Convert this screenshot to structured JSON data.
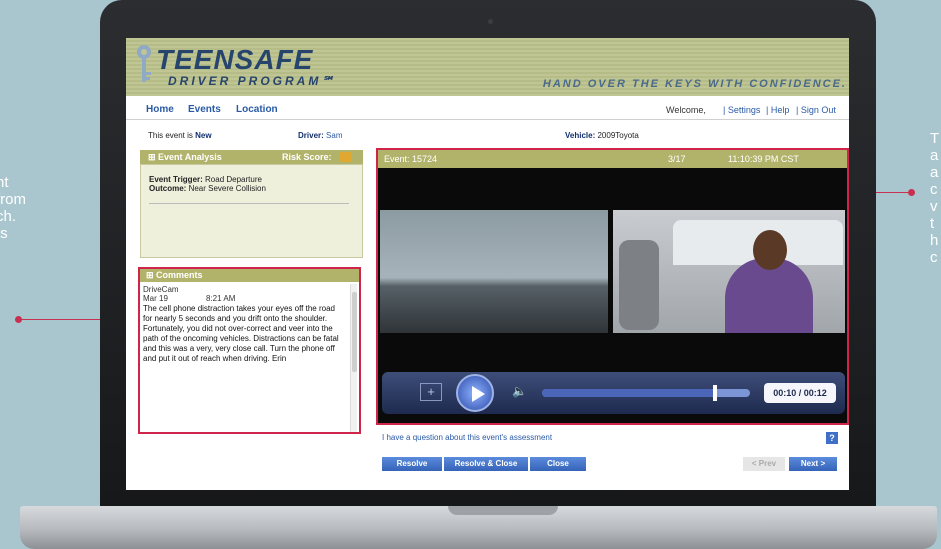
{
  "side_left": {
    "lines": [
      "nt",
      "from",
      "ch.",
      "ts"
    ]
  },
  "side_right": {
    "lines": [
      "T",
      "a",
      "a",
      "c",
      "v",
      "t",
      "h",
      "c"
    ]
  },
  "app": {
    "brand_title": "TEENSAFE",
    "brand_subtitle": "DRIVER PROGRAM℠",
    "tagline": "HAND OVER THE KEYS WITH CONFIDENCE."
  },
  "nav": {
    "items": [
      "Home",
      "Events",
      "Location"
    ],
    "welcome": "Welcome,",
    "settings": "| Settings",
    "help": "| Help",
    "signout": "| Sign Out"
  },
  "event_info": {
    "status_prefix": "This event is",
    "status_value": "New",
    "driver_label": "Driver:",
    "driver_value": "Sam",
    "vehicle_label": "Vehicle:",
    "vehicle_value": "2009Toyota"
  },
  "analysis": {
    "title": "Event Analysis",
    "risk_label": "Risk Score:",
    "trigger_label": "Event Trigger:",
    "trigger_value": "Road Departure",
    "outcome_label": "Outcome:",
    "outcome_value": "Near Severe Collision"
  },
  "comments": {
    "title": "Comments",
    "author": "DriveCam",
    "date": "Mar 19",
    "time": "8:21 AM",
    "text": "The cell phone distraction takes your eyes off the road for nearly 5 seconds and you drift onto the shoulder.  Fortunately, you did not over-correct and veer into the path of the oncoming vehicles.  Distractions can be fatal and this was a very, very close call.  Turn the phone off and put it out of reach when driving.  Erin"
  },
  "video": {
    "event_label": "Event: 15724",
    "date": "3/17",
    "time": "11:10:39 PM CST",
    "player_time": "00:10 / 00:12",
    "progress": 0.83
  },
  "actions": {
    "question_link": "I have a question about this event's assessment",
    "help": "?",
    "resolve": "Resolve",
    "resolve_close": "Resolve & Close",
    "close": "Close",
    "prev": "< Prev",
    "next": "Next >"
  },
  "colors": {
    "accent": "#d0254a",
    "panel_header": "#b2b36b",
    "link": "#2a5aa6",
    "button": "#3f6fc6"
  }
}
